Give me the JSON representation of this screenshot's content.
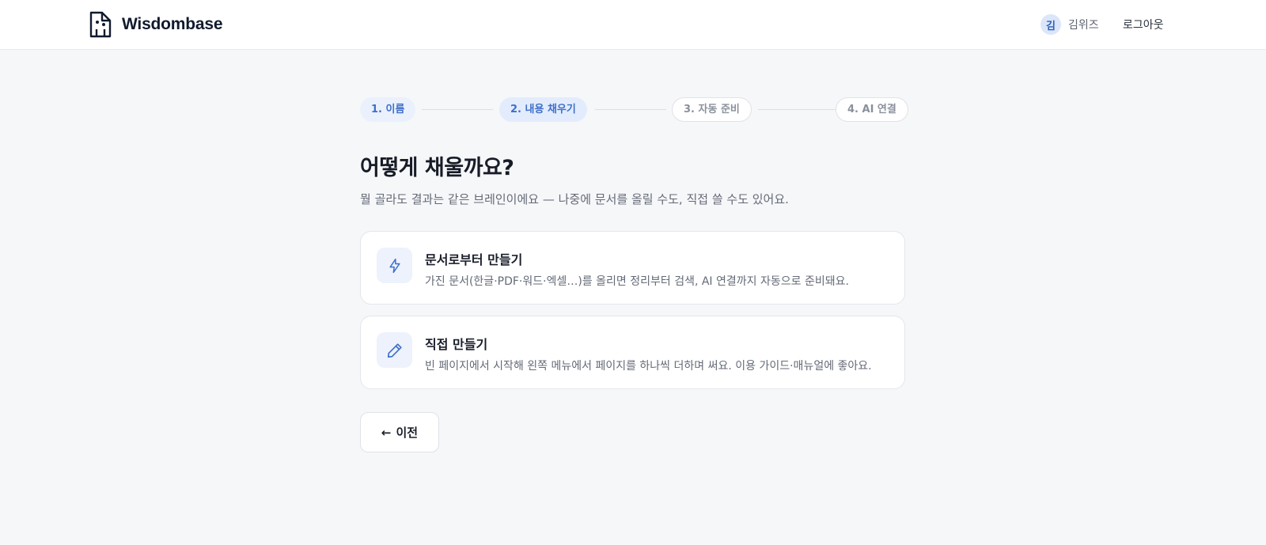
{
  "header": {
    "brand": "Wisdombase",
    "user_initial": "김",
    "user_name": "김위즈",
    "logout_label": "로그아웃"
  },
  "stepper": {
    "steps": [
      {
        "label": "1. 이름",
        "state": "done"
      },
      {
        "label": "2. 내용 채우기",
        "state": "active"
      },
      {
        "label": "3. 자동 준비",
        "state": "todo"
      },
      {
        "label": "4. AI 연결",
        "state": "todo"
      }
    ]
  },
  "main": {
    "title": "어떻게 채울까요?",
    "subtitle": "뭘 골라도 결과는 같은 브레인이에요 — 나중에 문서를 올릴 수도, 직접 쓸 수도 있어요.",
    "options": [
      {
        "icon": "lightning-icon",
        "title": "문서로부터 만들기",
        "description": "가진 문서(한글·PDF·워드·엑셀…)를 올리면 정리부터 검색, AI 연결까지 자동으로 준비돼요."
      },
      {
        "icon": "pencil-icon",
        "title": "직접 만들기",
        "description": "빈 페이지에서 시작해 왼쪽 메뉴에서 페이지를 하나씩 더하며 써요. 이용 가이드·매뉴얼에 좋아요."
      }
    ],
    "back_arrow": "←",
    "back_label": "이전"
  },
  "colors": {
    "accent": "#3f6fc9",
    "accent_soft": "#e3ecfd",
    "background": "#f6f7f9",
    "brand_text": "#111a2e"
  }
}
